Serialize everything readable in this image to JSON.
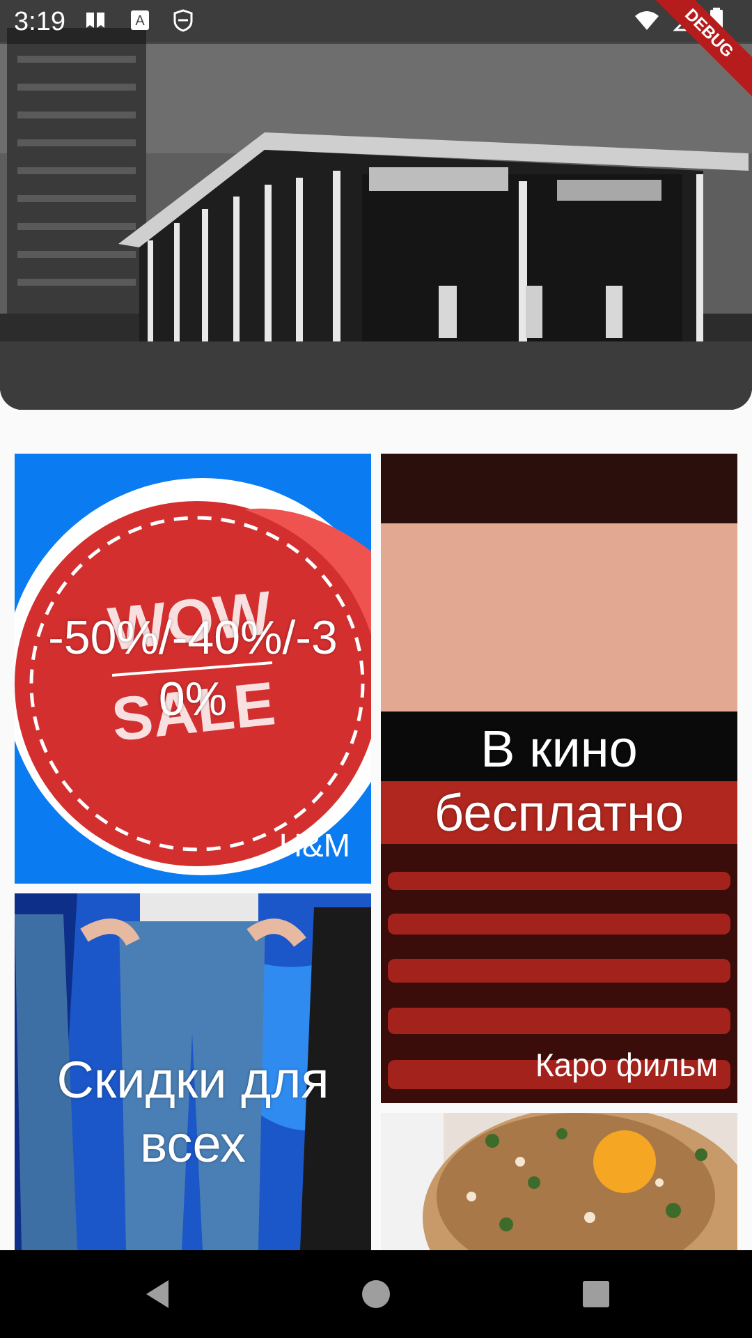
{
  "status_bar": {
    "time": "3:19",
    "left_icons": [
      "bookmark-icon",
      "text-recognition-icon",
      "shield-icon"
    ],
    "right_icons": [
      "wifi-icon",
      "cell-signal-icon",
      "battery-icon"
    ],
    "debug_label": "DEBUG"
  },
  "hero": {
    "image": "mid-century-building-photo"
  },
  "cards": {
    "hm": {
      "title": "-50%/-40%/-30%",
      "subtitle": "H&M",
      "image": "wow-sale-sticker"
    },
    "cinema": {
      "title": "В кино бесплатно",
      "subtitle": "Каро фильм",
      "image": "cinema-hall"
    },
    "jeans": {
      "title": "Скидки для всех",
      "image": "jeans-models"
    },
    "food": {
      "image": "food-dish"
    }
  },
  "nav_bar": {
    "buttons": [
      "back-icon",
      "home-icon",
      "recents-icon"
    ]
  },
  "colors": {
    "hm_card_bg": "#0a7bf0",
    "sticker_red": "#d32f2f",
    "cinema_screen": "#e8b39c",
    "jeans_bg": "#1b57c8",
    "debug_banner": "#b71c1c"
  }
}
